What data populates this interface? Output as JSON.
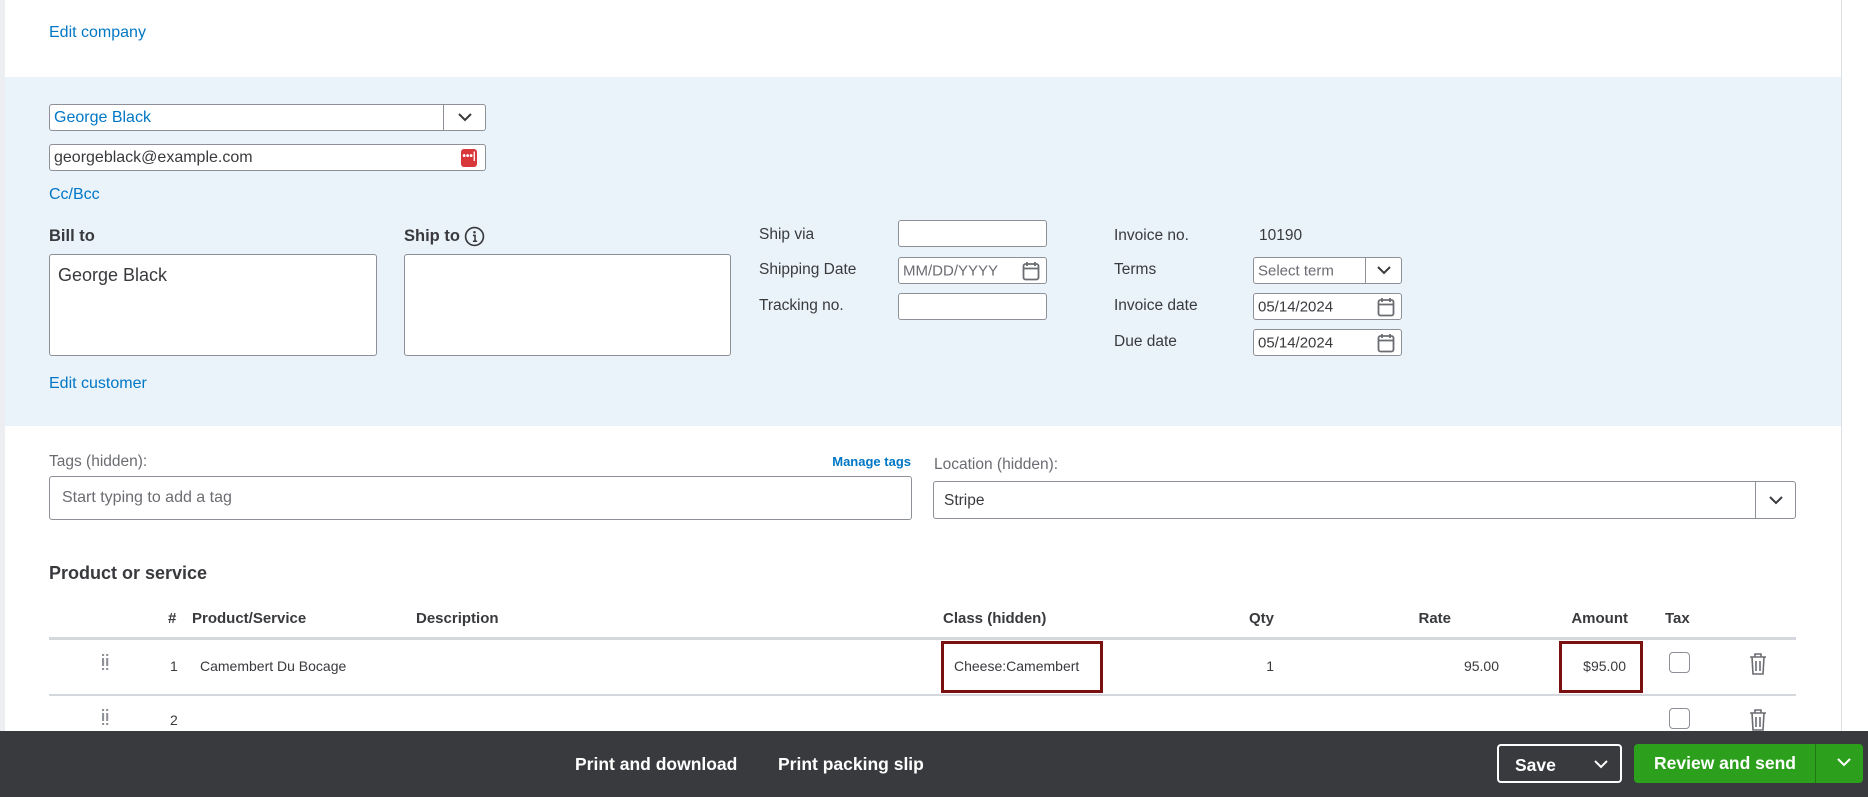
{
  "header": {
    "edit_company": "Edit company"
  },
  "customer": {
    "name": "George Black",
    "email": "georgeblack@example.com",
    "cc_bcc": "Cc/Bcc",
    "bill_to_label": "Bill to",
    "bill_to_value": "George Black",
    "ship_to_label": "Ship to",
    "ship_to_value": "",
    "edit_customer": "Edit customer"
  },
  "shipping": {
    "ship_via_label": "Ship via",
    "ship_via_value": "",
    "shipping_date_label": "Shipping Date",
    "shipping_date_placeholder": "MM/DD/YYYY",
    "tracking_label": "Tracking no.",
    "tracking_value": ""
  },
  "invoice": {
    "invoice_no_label": "Invoice no.",
    "invoice_no": "10190",
    "terms_label": "Terms",
    "terms_placeholder": "Select term",
    "invoice_date_label": "Invoice date",
    "invoice_date": "05/14/2024",
    "due_date_label": "Due date",
    "due_date": "05/14/2024"
  },
  "tags": {
    "label": "Tags (hidden):",
    "manage": "Manage tags",
    "placeholder": "Start typing to add a tag"
  },
  "location": {
    "label": "Location (hidden):",
    "value": "Stripe"
  },
  "products": {
    "title": "Product or service",
    "columns": {
      "num": "#",
      "product": "Product/Service",
      "description": "Description",
      "class": "Class (hidden)",
      "qty": "Qty",
      "rate": "Rate",
      "amount": "Amount",
      "tax": "Tax"
    },
    "rows": [
      {
        "num": "1",
        "product": "Camembert Du Bocage",
        "description": "",
        "class": "Cheese:Camembert",
        "qty": "1",
        "rate": "95.00",
        "amount": "$95.00"
      },
      {
        "num": "2",
        "product": "",
        "description": "",
        "class": "",
        "qty": "",
        "rate": "",
        "amount": ""
      }
    ]
  },
  "footer": {
    "print_download": "Print and download",
    "print_packing": "Print packing slip",
    "save": "Save",
    "review_send": "Review and send"
  },
  "colors": {
    "accent": "#0077c5",
    "panel": "#eaf2fa",
    "footer": "#393a3d",
    "primary": "#2ca01c",
    "highlight": "#7a1010"
  }
}
